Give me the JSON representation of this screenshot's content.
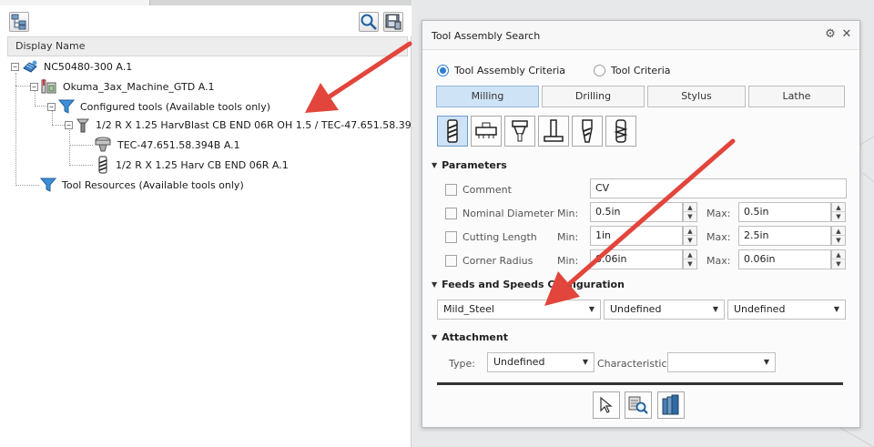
{
  "tree": {
    "column_header": "Display Name",
    "nodes": [
      {
        "label": "NC50480-300 A.1"
      },
      {
        "label": "Okuma_3ax_Machine_GTD A.1"
      },
      {
        "label": "Configured tools (Available tools only)"
      },
      {
        "label": "1/2 R X 1.25 HarvBlast CB END 06R OH 1.5 / TEC-47.651.58.39..."
      },
      {
        "label": "TEC-47.651.58.394B A.1"
      },
      {
        "label": "1/2 R X 1.25 Harv CB END 06R A.1"
      },
      {
        "label": "Tool Resources (Available tools only)"
      }
    ],
    "toolbar_icons": [
      "tree-structure-icon",
      "search-icon",
      "save-icon"
    ]
  },
  "dialog": {
    "title": "Tool Assembly Search",
    "radio": {
      "assembly": "Tool Assembly Criteria",
      "tool": "Tool Criteria",
      "selected": "assembly"
    },
    "tabs": [
      "Milling",
      "Drilling",
      "Stylus",
      "Lathe"
    ],
    "active_tab": "Milling",
    "tool_type_icons": [
      "end-mill-icon",
      "face-mill-icon",
      "drill-bit-icon",
      "t-slot-icon",
      "taper-mill-icon",
      "thread-mill-icon"
    ],
    "parameters": {
      "heading": "Parameters",
      "comment": {
        "label": "Comment",
        "value": "CV"
      },
      "min_label": "Min:",
      "max_label": "Max:",
      "rows": [
        {
          "label": "Nominal Diameter",
          "min": "0.5in",
          "max": "0.5in"
        },
        {
          "label": "Cutting Length",
          "min": "1in",
          "max": "2.5in"
        },
        {
          "label": "Corner Radius",
          "min": "0.06in",
          "max": "0.06in"
        }
      ]
    },
    "feeds": {
      "heading": "Feeds and Speeds Configuration",
      "dropdowns": [
        "Mild_Steel",
        "Undefined",
        "Undefined"
      ]
    },
    "attachment": {
      "heading": "Attachment",
      "type_label": "Type:",
      "type_value": "Undefined",
      "characteristic_label": "Characteristic:",
      "characteristic_value": ""
    },
    "bottom_icons": [
      "pointer-icon",
      "database-search-icon",
      "library-books-icon"
    ]
  },
  "colors": {
    "accent": "#2a7fd1",
    "active_tab": "#cfe3f7",
    "arrow": "#e2453b",
    "filter_icon": "#3d8fd6"
  }
}
